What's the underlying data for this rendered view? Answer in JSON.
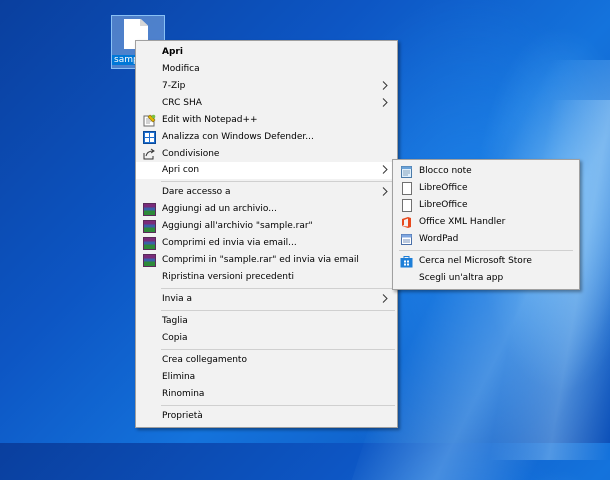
{
  "desktop": {
    "icon_label": "samp"
  },
  "context_menu": {
    "items": [
      {
        "label": "Apri",
        "bold": true
      },
      {
        "label": "Modifica"
      },
      {
        "label": "7-Zip",
        "submenu": true
      },
      {
        "label": "CRC SHA",
        "submenu": true
      },
      {
        "label": "Edit with Notepad++",
        "icon": "notepad-plus-icon"
      },
      {
        "label": "Analizza con Windows Defender...",
        "icon": "windows-defender-icon"
      },
      {
        "label": "Condivisione",
        "icon": "share-icon"
      },
      {
        "label": "Apri con",
        "submenu": true,
        "highlighted": true
      },
      {
        "label": "Dare accesso a",
        "submenu": true
      },
      {
        "label": "Aggiungi ad un archivio...",
        "icon": "winrar-icon"
      },
      {
        "label": "Aggiungi all'archivio \"sample.rar\"",
        "icon": "winrar-icon"
      },
      {
        "label": "Comprimi ed invia via email...",
        "icon": "winrar-icon"
      },
      {
        "label": "Comprimi in \"sample.rar\" ed invia via email",
        "icon": "winrar-icon"
      },
      {
        "label": "Ripristina versioni precedenti"
      },
      {
        "label": "Invia a",
        "submenu": true
      },
      {
        "label": "Taglia"
      },
      {
        "label": "Copia"
      },
      {
        "label": "Crea collegamento"
      },
      {
        "label": "Elimina"
      },
      {
        "label": "Rinomina"
      },
      {
        "label": "Proprietà"
      }
    ]
  },
  "open_with_submenu": {
    "items": [
      {
        "label": "Blocco note",
        "icon": "notepad-icon"
      },
      {
        "label": "LibreOffice",
        "icon": "document-icon"
      },
      {
        "label": "LibreOffice",
        "icon": "document-icon"
      },
      {
        "label": "Office XML Handler",
        "icon": "office-icon"
      },
      {
        "label": "WordPad",
        "icon": "wordpad-icon"
      },
      {
        "label": "Cerca nel Microsoft Store",
        "icon": "store-icon"
      },
      {
        "label": "Scegli un'altra app"
      }
    ]
  }
}
